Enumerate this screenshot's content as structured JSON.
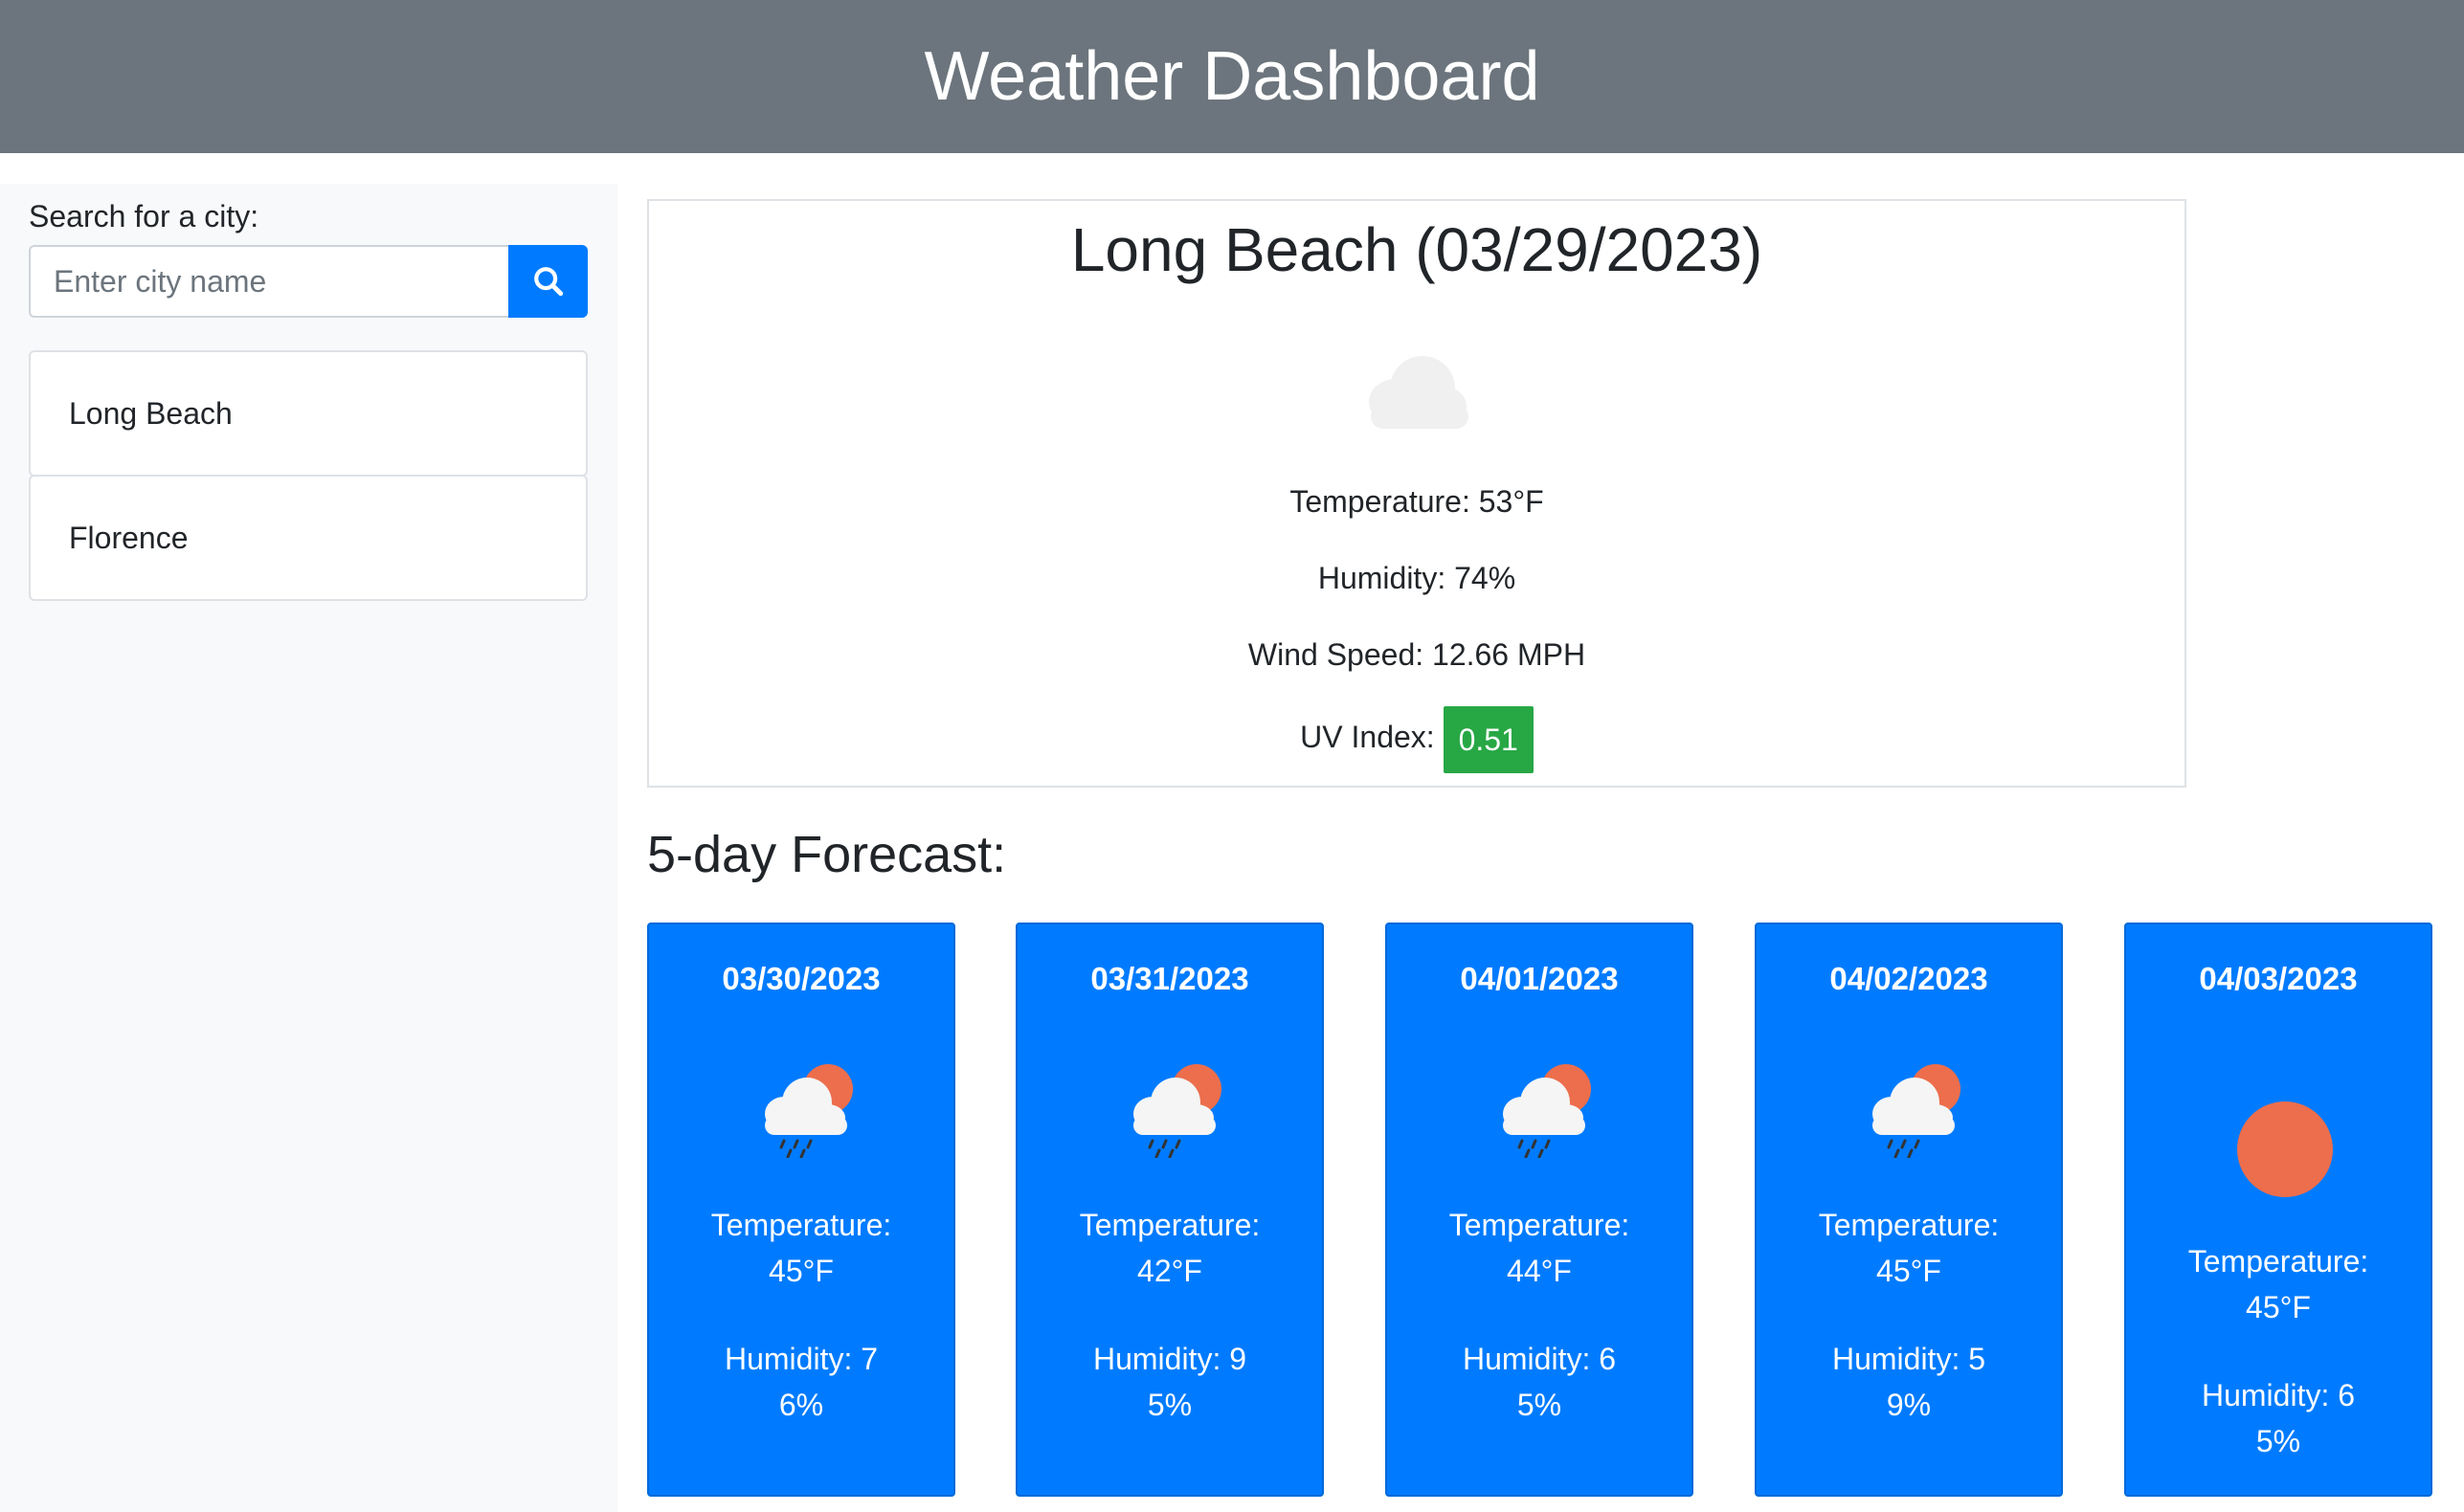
{
  "header": {
    "title": "Weather Dashboard"
  },
  "sidebar": {
    "search_label": "Search for a city:",
    "search_placeholder": "Enter city name",
    "history": [
      {
        "city": "Long Beach"
      },
      {
        "city": "Florence"
      }
    ]
  },
  "current": {
    "title": "Long Beach (03/29/2023)",
    "icon": "cloud-icon",
    "temperature": "Temperature: 53°F",
    "humidity": "Humidity: 74%",
    "wind": "Wind Speed: 12.66 MPH",
    "uv_label": "UV Index:",
    "uv_value": "0.51",
    "uv_color": "#28a745"
  },
  "forecast": {
    "heading": "5-day Forecast:",
    "days": [
      {
        "date": "03/30/2023",
        "icon": "rain-sun-icon",
        "temp": "Temperature: 45°F",
        "humidity": "Humidity: 76%"
      },
      {
        "date": "03/31/2023",
        "icon": "rain-sun-icon",
        "temp": "Temperature: 42°F",
        "humidity": "Humidity: 95%"
      },
      {
        "date": "04/01/2023",
        "icon": "rain-sun-icon",
        "temp": "Temperature: 44°F",
        "humidity": "Humidity: 65%"
      },
      {
        "date": "04/02/2023",
        "icon": "rain-sun-icon",
        "temp": "Temperature: 45°F",
        "humidity": "Humidity: 59%"
      },
      {
        "date": "04/03/2023",
        "icon": "sun-icon",
        "temp": "Temperature: 45°F",
        "humidity": "Humidity: 65%"
      }
    ]
  },
  "colors": {
    "header": "#6c757d",
    "accent": "#007bff",
    "sun": "#ec6e4c"
  }
}
